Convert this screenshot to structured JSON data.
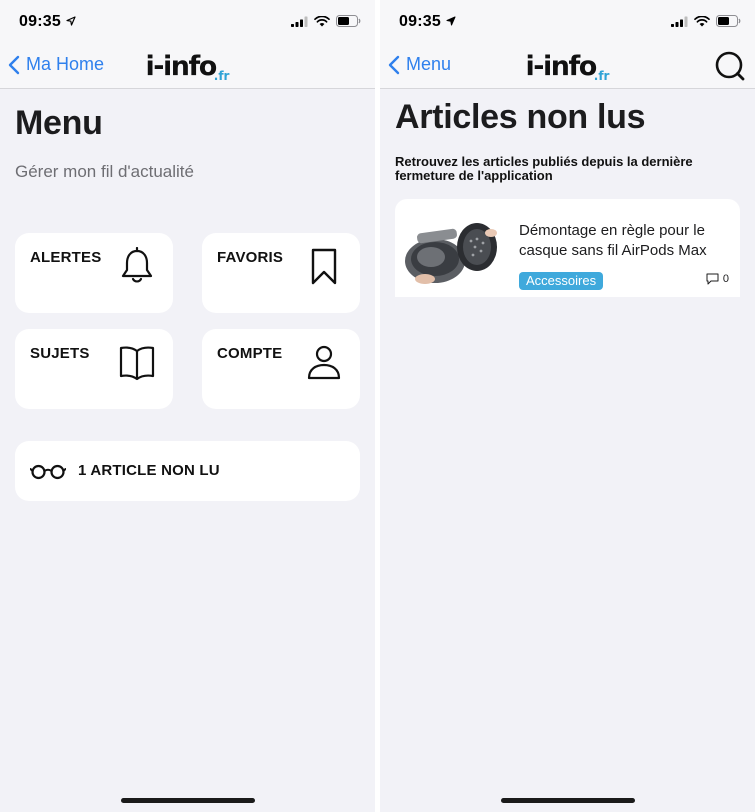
{
  "status_bar": {
    "left_time": "09:35",
    "right_time": "09:35"
  },
  "left_screen": {
    "nav": {
      "back_label": "Ma Home"
    },
    "logo": {
      "main": "i-info",
      "tld": ".fr"
    },
    "title": "Menu",
    "subtitle": "Gérer mon fil d'actualité",
    "tiles": [
      {
        "label": "ALERTES",
        "icon": "bell-icon"
      },
      {
        "label": "FAVORIS",
        "icon": "bookmark-icon"
      },
      {
        "label": "SUJETS",
        "icon": "book-icon"
      },
      {
        "label": "COMPTE",
        "icon": "person-icon"
      }
    ],
    "unread": {
      "label": "1 ARTICLE NON LU",
      "icon": "glasses-icon"
    }
  },
  "right_screen": {
    "nav": {
      "back_label": "Menu",
      "search_icon": "search-icon"
    },
    "logo": {
      "main": "i-info",
      "tld": ".fr"
    },
    "title": "Articles non lus",
    "description": "Retrouvez les articles publiés depuis la dernière fermeture de l'application",
    "articles": [
      {
        "title": "Démontage en règle pour le casque sans fil AirPods Max",
        "category": "Accessoires",
        "comments": "0"
      }
    ]
  },
  "colors": {
    "accent": "#2f80ed",
    "badge": "#3fa9dc",
    "background": "#f2f2f7",
    "card": "#ffffff"
  }
}
